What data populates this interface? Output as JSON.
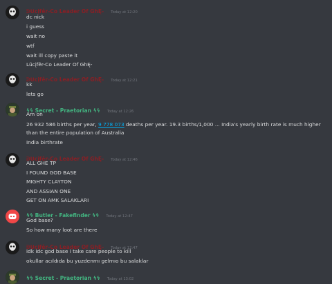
{
  "colors": {
    "background": "#36393f",
    "text": "#dcddde",
    "timestamp": "#72767d",
    "red_user": "#8a1f25",
    "green_user": "#43b581",
    "link": "#00b0f4",
    "discord_blurple": "#f04747"
  },
  "messages": [
    {
      "user": "ᕲᑌcįfêr-Co Leader Of GhĘ-",
      "timestamp": "Today at 12:20",
      "avatar_icon": "skull-avatar-icon",
      "lines": [
        "dc nick",
        "i guess",
        "wait no",
        "wtf",
        "wait ill  copy paste it",
        "Lücįfêr-Co Leader Of GhĘ-"
      ]
    },
    {
      "user": "ᕲᑌcįfêr-Co Leader Of GhĘ-",
      "timestamp": "Today at 12:21",
      "avatar_icon": "skull-avatar-icon",
      "lines": [
        "kk",
        "lets go"
      ]
    },
    {
      "user": "ϟϟ Secret - Praetorian ϟϟ",
      "timestamp": "Today at 12:26",
      "avatar_icon": "soldier-avatar-icon",
      "lines": [
        "Am on"
      ],
      "rich": {
        "prefix": "26 932 586 births per year, ",
        "link": "9 778 073",
        "suffix": " deaths per year. 19.3 births/1,000 ... India's yearly birth rate is much higher than the entire population of Australia"
      },
      "after_lines": [
        "India birthrate"
      ]
    },
    {
      "user": "ᕲᑌcįfêr-Co Leader Of GhĘ-",
      "timestamp": "Today at 12:46",
      "avatar_icon": "skull-avatar-icon",
      "lines": [
        "ALL GHE TP",
        "I FOUND GOD BASE",
        "MIGHTY CLAYTON",
        "AND ASSIAN ONE",
        "GET ON AMK SALAKLARI"
      ]
    },
    {
      "user": "ϟϟ Butler - Fakefinder ϟϟ",
      "timestamp": "Today at 12:47",
      "avatar_icon": "discord-logo-icon",
      "lines": [
        "God base?",
        "So how many loot are there"
      ]
    },
    {
      "user": "ᕲᑌcįfêr-Co Leader Of GhĘ-",
      "timestamp": "Today at 12:47",
      "avatar_icon": "skull-avatar-icon",
      "lines": [
        "idk idc god base i take care people to kill",
        "okullar acıldıda bu yuzdenmı gelmıo bu salaklar"
      ]
    },
    {
      "user": "ϟϟ Secret - Praetorian ϟϟ",
      "timestamp": "Today at 13:02",
      "avatar_icon": "soldier-avatar-icon",
      "lines": []
    }
  ]
}
